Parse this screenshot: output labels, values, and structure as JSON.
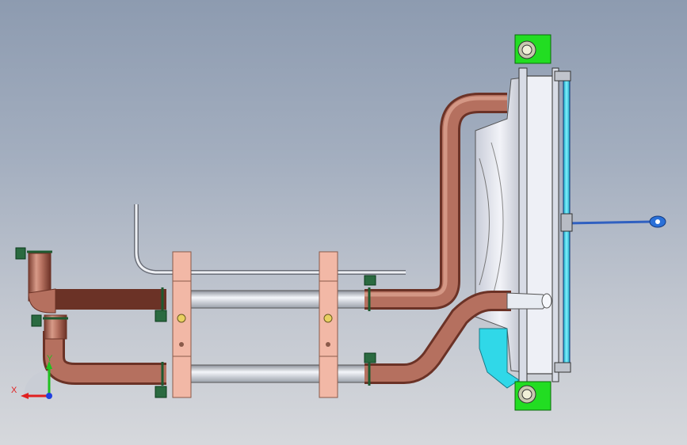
{
  "viewport": {
    "background_top": "#8d9bb0",
    "background_bottom": "#d6d8dc"
  },
  "colors": {
    "copper_pipe": "#b5705f",
    "copper_dark": "#7a3d30",
    "steel_pipe": "#e8ecf2",
    "bracket": "#f2b8a6",
    "mount_plate": "#22dd22",
    "radiator_rod": "#40e0f0",
    "coolant_tank": "#30d8e8",
    "clamp": "#2a6a40"
  },
  "triad": {
    "x_label": "X",
    "y_label": "Y",
    "x_color": "#e02020",
    "y_color": "#20c020",
    "z_color": "#2040e0"
  }
}
